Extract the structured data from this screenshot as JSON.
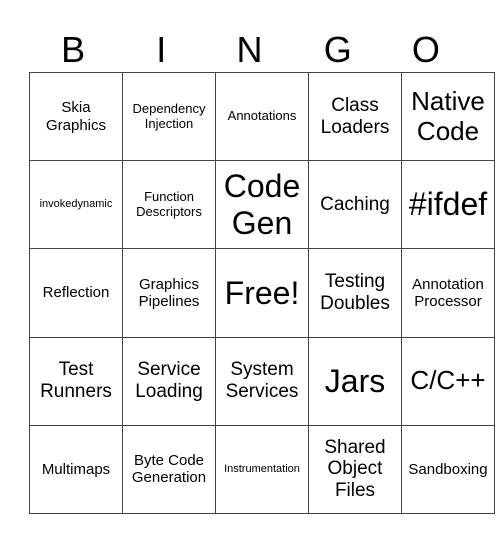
{
  "title_letters": [
    "B",
    "I",
    "N",
    "G",
    "O"
  ],
  "rows": [
    [
      {
        "text": "Skia Graphics",
        "size": "md"
      },
      {
        "text": "Dependency Injection",
        "size": "sm"
      },
      {
        "text": "Annotations",
        "size": "sm"
      },
      {
        "text": "Class Loaders",
        "size": "lg"
      },
      {
        "text": "Native Code",
        "size": "xl"
      }
    ],
    [
      {
        "text": "invokedynamic",
        "size": "xs"
      },
      {
        "text": "Function Descriptors",
        "size": "sm"
      },
      {
        "text": "Code Gen",
        "size": "xxl"
      },
      {
        "text": "Caching",
        "size": "lg"
      },
      {
        "text": "#ifdef",
        "size": "xxl"
      }
    ],
    [
      {
        "text": "Reflection",
        "size": "md"
      },
      {
        "text": "Graphics Pipelines",
        "size": "md"
      },
      {
        "text": "Free!",
        "size": "xxl"
      },
      {
        "text": "Testing Doubles",
        "size": "lg"
      },
      {
        "text": "Annotation Processor",
        "size": "md"
      }
    ],
    [
      {
        "text": "Test Runners",
        "size": "lg"
      },
      {
        "text": "Service Loading",
        "size": "lg"
      },
      {
        "text": "System Services",
        "size": "lg"
      },
      {
        "text": "Jars",
        "size": "xxl"
      },
      {
        "text": "C/C++",
        "size": "xl"
      }
    ],
    [
      {
        "text": "Multimaps",
        "size": "md"
      },
      {
        "text": "Byte Code Generation",
        "size": "md"
      },
      {
        "text": "Instrumentation",
        "size": "xs"
      },
      {
        "text": "Shared Object Files",
        "size": "lg"
      },
      {
        "text": "Sandboxing",
        "size": "md"
      }
    ]
  ]
}
